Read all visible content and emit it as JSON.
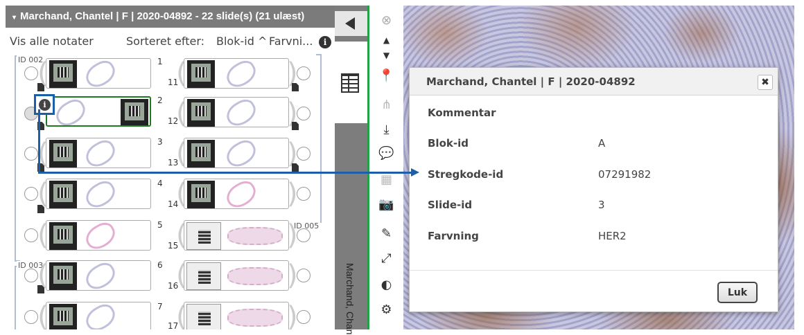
{
  "case_header": {
    "caret": "▾",
    "title": "Marchand, Chantel | F | 2020-04892 - 22 slide(s) (21 ulæst)"
  },
  "sort_row": {
    "show_all": "Vis alle notater",
    "sort_label": "Sorteret efter:",
    "sort_by": "Blok-id ^",
    "sort_stain": "Farvni...",
    "info": "i"
  },
  "groups": {
    "id_002": "ID 002",
    "id_003": "ID 003",
    "id_005": "ID 005"
  },
  "slide_numbers": {
    "left": [
      "1",
      "2",
      "3",
      "4",
      "5",
      "6",
      "7"
    ],
    "right": [
      "11",
      "12",
      "13",
      "14",
      "15",
      "16",
      "17"
    ]
  },
  "info_button": "i",
  "vertical_name": "Marchand, Chant",
  "toolbar_icons": [
    "close-circle-icon",
    "chevron-up-icon",
    "chevron-down-icon",
    "pin-icon",
    "hierarchy-icon",
    "download-icon",
    "comments-icon",
    "grid-icon",
    "camera-icon",
    "pencil-icon",
    "expand-icon",
    "contrast-icon",
    "gear-icon"
  ],
  "dialog": {
    "title": "Marchand, Chantel | F | 2020-04892",
    "close_glyph": "✖",
    "fields": [
      {
        "label": "Kommentar",
        "value": ""
      },
      {
        "label": "Blok-id",
        "value": "A"
      },
      {
        "label": "Stregkode-id",
        "value": "07291982"
      },
      {
        "label": "Slide-id",
        "value": "3"
      },
      {
        "label": "Farvning",
        "value": "HER2"
      }
    ],
    "close_button": "Luk"
  },
  "colors": {
    "header_gray": "#7b7b7b",
    "callout_blue": "#1a5fa8",
    "selected_green": "#1e7a1e",
    "toolbar_border_green": "#24a046"
  }
}
